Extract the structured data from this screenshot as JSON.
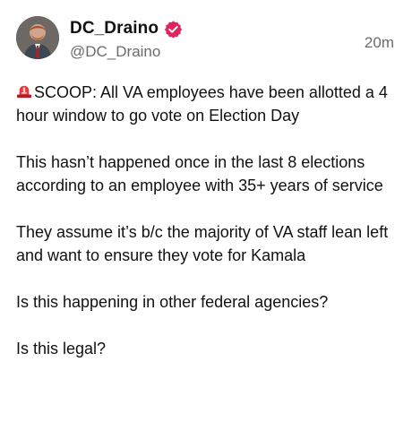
{
  "post": {
    "author": {
      "display_name": "DC_Draino",
      "handle": "@DC_Draino",
      "avatar_icon": "profile-photo-avatar",
      "verified_icon": "verified-badge-icon",
      "verified_color": "#e0245e"
    },
    "timestamp": "20m",
    "emoji_icon": "police-siren-icon",
    "paragraphs": [
      "SCOOP: All VA employees have been allotted a 4 hour window to go vote on Election Day",
      "This hasn’t happened once in the last 8 elections according to an employee with 35+ years of service",
      "They assume it’s b/c the majority of VA staff lean left and want to ensure they vote for Kamala",
      "Is this happening in other federal agencies?",
      "Is this legal?"
    ]
  }
}
